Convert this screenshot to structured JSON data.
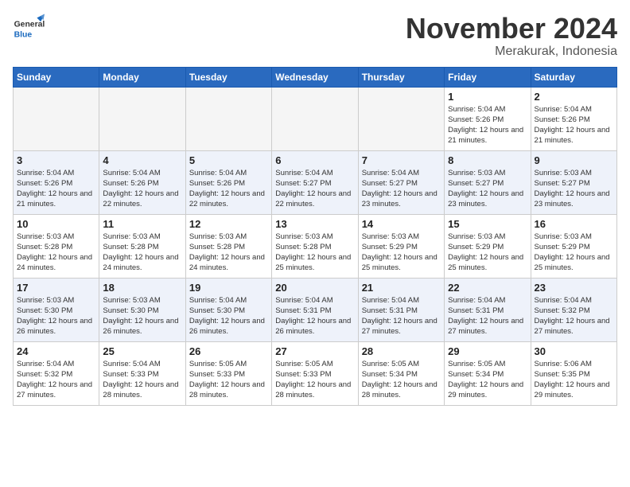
{
  "header": {
    "logo_general": "General",
    "logo_blue": "Blue",
    "month_title": "November 2024",
    "location": "Merakurak, Indonesia"
  },
  "days_of_week": [
    "Sunday",
    "Monday",
    "Tuesday",
    "Wednesday",
    "Thursday",
    "Friday",
    "Saturday"
  ],
  "weeks": [
    [
      {
        "day": "",
        "info": ""
      },
      {
        "day": "",
        "info": ""
      },
      {
        "day": "",
        "info": ""
      },
      {
        "day": "",
        "info": ""
      },
      {
        "day": "",
        "info": ""
      },
      {
        "day": "1",
        "info": "Sunrise: 5:04 AM\nSunset: 5:26 PM\nDaylight: 12 hours\nand 21 minutes."
      },
      {
        "day": "2",
        "info": "Sunrise: 5:04 AM\nSunset: 5:26 PM\nDaylight: 12 hours\nand 21 minutes."
      }
    ],
    [
      {
        "day": "3",
        "info": "Sunrise: 5:04 AM\nSunset: 5:26 PM\nDaylight: 12 hours\nand 21 minutes."
      },
      {
        "day": "4",
        "info": "Sunrise: 5:04 AM\nSunset: 5:26 PM\nDaylight: 12 hours\nand 22 minutes."
      },
      {
        "day": "5",
        "info": "Sunrise: 5:04 AM\nSunset: 5:26 PM\nDaylight: 12 hours\nand 22 minutes."
      },
      {
        "day": "6",
        "info": "Sunrise: 5:04 AM\nSunset: 5:27 PM\nDaylight: 12 hours\nand 22 minutes."
      },
      {
        "day": "7",
        "info": "Sunrise: 5:04 AM\nSunset: 5:27 PM\nDaylight: 12 hours\nand 23 minutes."
      },
      {
        "day": "8",
        "info": "Sunrise: 5:03 AM\nSunset: 5:27 PM\nDaylight: 12 hours\nand 23 minutes."
      },
      {
        "day": "9",
        "info": "Sunrise: 5:03 AM\nSunset: 5:27 PM\nDaylight: 12 hours\nand 23 minutes."
      }
    ],
    [
      {
        "day": "10",
        "info": "Sunrise: 5:03 AM\nSunset: 5:28 PM\nDaylight: 12 hours\nand 24 minutes."
      },
      {
        "day": "11",
        "info": "Sunrise: 5:03 AM\nSunset: 5:28 PM\nDaylight: 12 hours\nand 24 minutes."
      },
      {
        "day": "12",
        "info": "Sunrise: 5:03 AM\nSunset: 5:28 PM\nDaylight: 12 hours\nand 24 minutes."
      },
      {
        "day": "13",
        "info": "Sunrise: 5:03 AM\nSunset: 5:28 PM\nDaylight: 12 hours\nand 25 minutes."
      },
      {
        "day": "14",
        "info": "Sunrise: 5:03 AM\nSunset: 5:29 PM\nDaylight: 12 hours\nand 25 minutes."
      },
      {
        "day": "15",
        "info": "Sunrise: 5:03 AM\nSunset: 5:29 PM\nDaylight: 12 hours\nand 25 minutes."
      },
      {
        "day": "16",
        "info": "Sunrise: 5:03 AM\nSunset: 5:29 PM\nDaylight: 12 hours\nand 25 minutes."
      }
    ],
    [
      {
        "day": "17",
        "info": "Sunrise: 5:03 AM\nSunset: 5:30 PM\nDaylight: 12 hours\nand 26 minutes."
      },
      {
        "day": "18",
        "info": "Sunrise: 5:03 AM\nSunset: 5:30 PM\nDaylight: 12 hours\nand 26 minutes."
      },
      {
        "day": "19",
        "info": "Sunrise: 5:04 AM\nSunset: 5:30 PM\nDaylight: 12 hours\nand 26 minutes."
      },
      {
        "day": "20",
        "info": "Sunrise: 5:04 AM\nSunset: 5:31 PM\nDaylight: 12 hours\nand 26 minutes."
      },
      {
        "day": "21",
        "info": "Sunrise: 5:04 AM\nSunset: 5:31 PM\nDaylight: 12 hours\nand 27 minutes."
      },
      {
        "day": "22",
        "info": "Sunrise: 5:04 AM\nSunset: 5:31 PM\nDaylight: 12 hours\nand 27 minutes."
      },
      {
        "day": "23",
        "info": "Sunrise: 5:04 AM\nSunset: 5:32 PM\nDaylight: 12 hours\nand 27 minutes."
      }
    ],
    [
      {
        "day": "24",
        "info": "Sunrise: 5:04 AM\nSunset: 5:32 PM\nDaylight: 12 hours\nand 27 minutes."
      },
      {
        "day": "25",
        "info": "Sunrise: 5:04 AM\nSunset: 5:33 PM\nDaylight: 12 hours\nand 28 minutes."
      },
      {
        "day": "26",
        "info": "Sunrise: 5:05 AM\nSunset: 5:33 PM\nDaylight: 12 hours\nand 28 minutes."
      },
      {
        "day": "27",
        "info": "Sunrise: 5:05 AM\nSunset: 5:33 PM\nDaylight: 12 hours\nand 28 minutes."
      },
      {
        "day": "28",
        "info": "Sunrise: 5:05 AM\nSunset: 5:34 PM\nDaylight: 12 hours\nand 28 minutes."
      },
      {
        "day": "29",
        "info": "Sunrise: 5:05 AM\nSunset: 5:34 PM\nDaylight: 12 hours\nand 29 minutes."
      },
      {
        "day": "30",
        "info": "Sunrise: 5:06 AM\nSunset: 5:35 PM\nDaylight: 12 hours\nand 29 minutes."
      }
    ]
  ]
}
